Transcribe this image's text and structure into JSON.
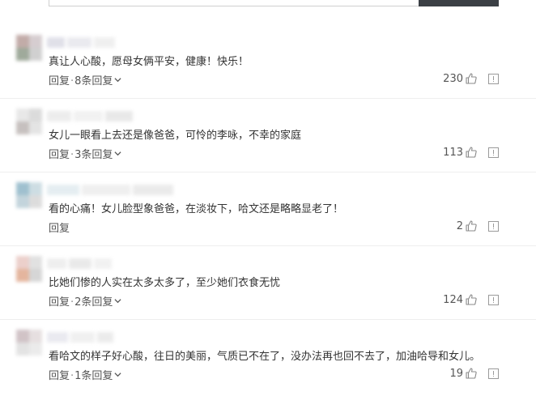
{
  "labels": {
    "reply": "回复",
    "separator": "·"
  },
  "comments": [
    {
      "text": "真让人心酸，愿母女俩平安，健康！快乐！",
      "meta": "",
      "replies_label": "8条回复",
      "likes": "230",
      "avatar_colors": [
        "#b89e9a",
        "#cfc5c8",
        "#8f9c8a",
        "#c8c8c8"
      ]
    },
    {
      "text": "女儿一眼看上去还是像爸爸，可怜的李咏，不幸的家庭",
      "meta": "",
      "replies_label": "3条回复",
      "likes": "113",
      "avatar_colors": [
        "#e4e4e4",
        "#d5d5d5",
        "#bdb6b4",
        "#e0e0e0"
      ]
    },
    {
      "text": "看的心痛！女儿脸型象爸爸，在淡妆下，哈文还是略略显老了！",
      "meta": "",
      "replies_label": "",
      "likes": "2",
      "avatar_colors": [
        "#8fb6c7",
        "#c5d8df",
        "#b9cdd6",
        "#d7d7d7"
      ]
    },
    {
      "text": "比她们惨的人实在太多太多了，至少她们衣食无忧",
      "meta": "",
      "replies_label": "2条回复",
      "likes": "124",
      "avatar_colors": [
        "#e9c8c3",
        "#dcdcdc",
        "#e0a98e",
        "#cfcfcf"
      ]
    },
    {
      "text": "看哈文的样子好心酸，往日的美丽，气质已不在了，没办法再也回不去了，加油哈导和女儿。",
      "meta": "",
      "replies_label": "1条回复",
      "likes": "19",
      "avatar_colors": [
        "#c9b9bd",
        "#e2dadb",
        "#dfdfdf",
        "#e8e8e8"
      ]
    }
  ]
}
